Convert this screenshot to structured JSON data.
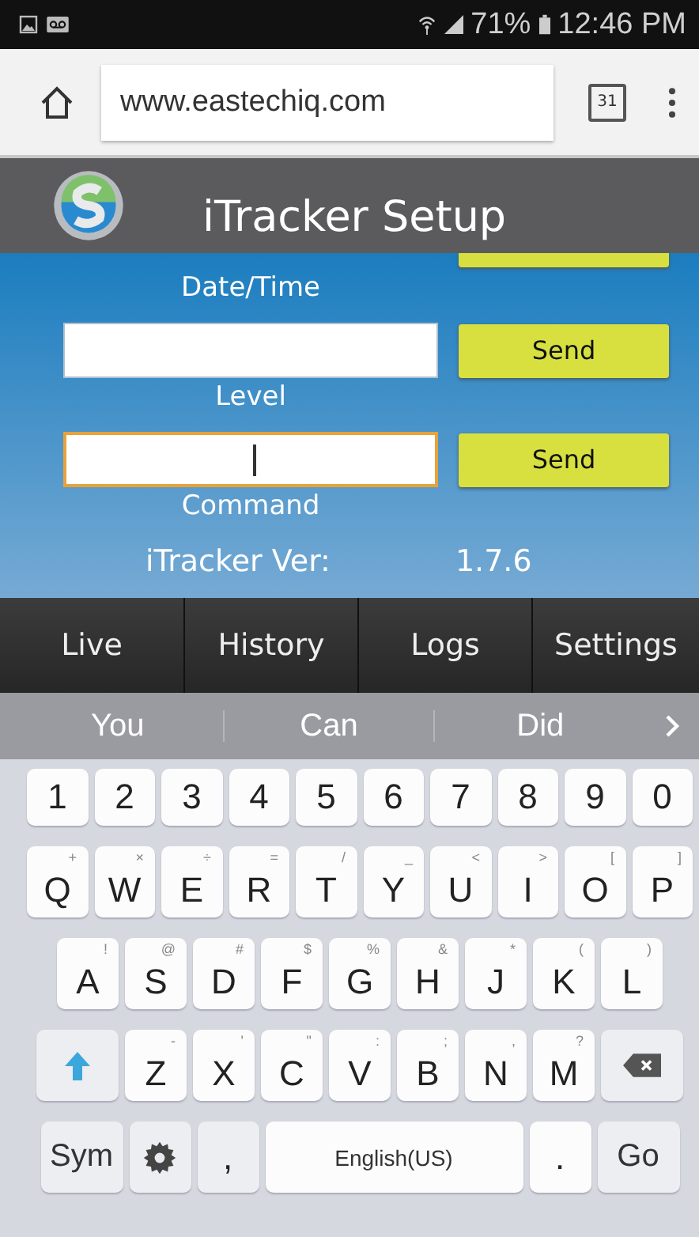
{
  "status_bar": {
    "battery": "71%",
    "time": "12:46 PM"
  },
  "browser": {
    "url": "www.eastechiq.com",
    "tab_count": "31"
  },
  "app": {
    "title": "iTracker Setup"
  },
  "form": {
    "top_label": "Date/Time",
    "rows": [
      {
        "button": "Send",
        "label": "Level",
        "focused": false
      },
      {
        "button": "Send",
        "label": "Command",
        "focused": true
      }
    ],
    "version": {
      "label": "iTracker Ver:",
      "value": "1.7.6"
    }
  },
  "nav_tabs": [
    "Live",
    "History",
    "Logs",
    "Settings"
  ],
  "suggestions": [
    "You",
    "Can",
    "Did"
  ],
  "keyboard": {
    "numbers": [
      "1",
      "2",
      "3",
      "4",
      "5",
      "6",
      "7",
      "8",
      "9",
      "0"
    ],
    "letter_rows": [
      [
        {
          "key": "Q",
          "alt": "+"
        },
        {
          "key": "W",
          "alt": "×"
        },
        {
          "key": "E",
          "alt": "÷"
        },
        {
          "key": "R",
          "alt": "="
        },
        {
          "key": "T",
          "alt": "/"
        },
        {
          "key": "Y",
          "alt": "_"
        },
        {
          "key": "U",
          "alt": "<"
        },
        {
          "key": "I",
          "alt": ">"
        },
        {
          "key": "O",
          "alt": "["
        },
        {
          "key": "P",
          "alt": "]"
        }
      ],
      [
        {
          "key": "A",
          "alt": "!"
        },
        {
          "key": "S",
          "alt": "@"
        },
        {
          "key": "D",
          "alt": "#"
        },
        {
          "key": "F",
          "alt": "$"
        },
        {
          "key": "G",
          "alt": "%"
        },
        {
          "key": "H",
          "alt": "&"
        },
        {
          "key": "J",
          "alt": "*"
        },
        {
          "key": "K",
          "alt": "("
        },
        {
          "key": "L",
          "alt": ")"
        }
      ],
      [
        {
          "key": "Z",
          "alt": "-"
        },
        {
          "key": "X",
          "alt": "'"
        },
        {
          "key": "C",
          "alt": "\""
        },
        {
          "key": "V",
          "alt": ":"
        },
        {
          "key": "B",
          "alt": ";"
        },
        {
          "key": "N",
          "alt": ","
        },
        {
          "key": "M",
          "alt": "?"
        }
      ]
    ],
    "sym": "Sym",
    "comma": ",",
    "space": "English(US)",
    "period": ".",
    "go": "Go"
  }
}
